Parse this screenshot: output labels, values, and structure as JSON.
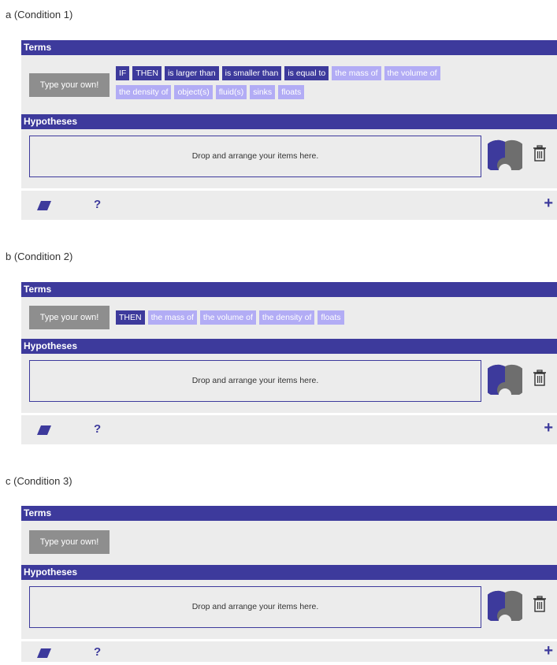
{
  "conditions": [
    {
      "label": "a (Condition 1)",
      "terms_header": "Terms",
      "type_your_own": "Type your own!",
      "chip_rows": [
        [
          {
            "text": "IF",
            "style": "dark"
          },
          {
            "text": "THEN",
            "style": "dark"
          },
          {
            "text": "is larger than",
            "style": "dark"
          },
          {
            "text": "is smaller than",
            "style": "dark"
          },
          {
            "text": "is equal to",
            "style": "dark"
          },
          {
            "text": "the mass of",
            "style": "light"
          },
          {
            "text": "the volume of",
            "style": "light"
          }
        ],
        [
          {
            "text": "the density of",
            "style": "light"
          },
          {
            "text": "object(s)",
            "style": "light"
          },
          {
            "text": "fluid(s)",
            "style": "light"
          },
          {
            "text": "sinks",
            "style": "light"
          },
          {
            "text": "floats",
            "style": "light"
          }
        ]
      ],
      "hypotheses_header": "Hypotheses",
      "dropzone_text": "Drop and arrange your items here.",
      "help_label": "?",
      "plus_label": "+"
    },
    {
      "label": "b (Condition 2)",
      "terms_header": "Terms",
      "type_your_own": "Type your own!",
      "chip_rows": [
        [
          {
            "text": "THEN",
            "style": "dark"
          },
          {
            "text": "the mass of",
            "style": "light"
          },
          {
            "text": "the volume of",
            "style": "light"
          },
          {
            "text": "the density of",
            "style": "light"
          },
          {
            "text": "floats",
            "style": "light"
          }
        ]
      ],
      "hypotheses_header": "Hypotheses",
      "dropzone_text": "Drop and arrange your items here.",
      "help_label": "?",
      "plus_label": "+"
    },
    {
      "label": "c (Condition 3)",
      "terms_header": "Terms",
      "type_your_own": "Type your own!",
      "chip_rows": [],
      "hypotheses_header": "Hypotheses",
      "dropzone_text": "Drop and arrange your items here.",
      "help_label": "?",
      "plus_label": "+"
    }
  ],
  "colors": {
    "header": "#3d3a9c",
    "chip_dark": "#3d3a9c",
    "chip_light": "#b2acf5",
    "panel_bg": "#ececec",
    "type_own_bg": "#8e8e8e",
    "gauge_dark": "#3d3a9c",
    "gauge_grey": "#6e6e6e"
  },
  "icons": {
    "eraser": "eraser-icon",
    "help": "help-icon",
    "add": "plus-icon",
    "delete": "trash-icon",
    "gauge": "gauge-icon"
  }
}
